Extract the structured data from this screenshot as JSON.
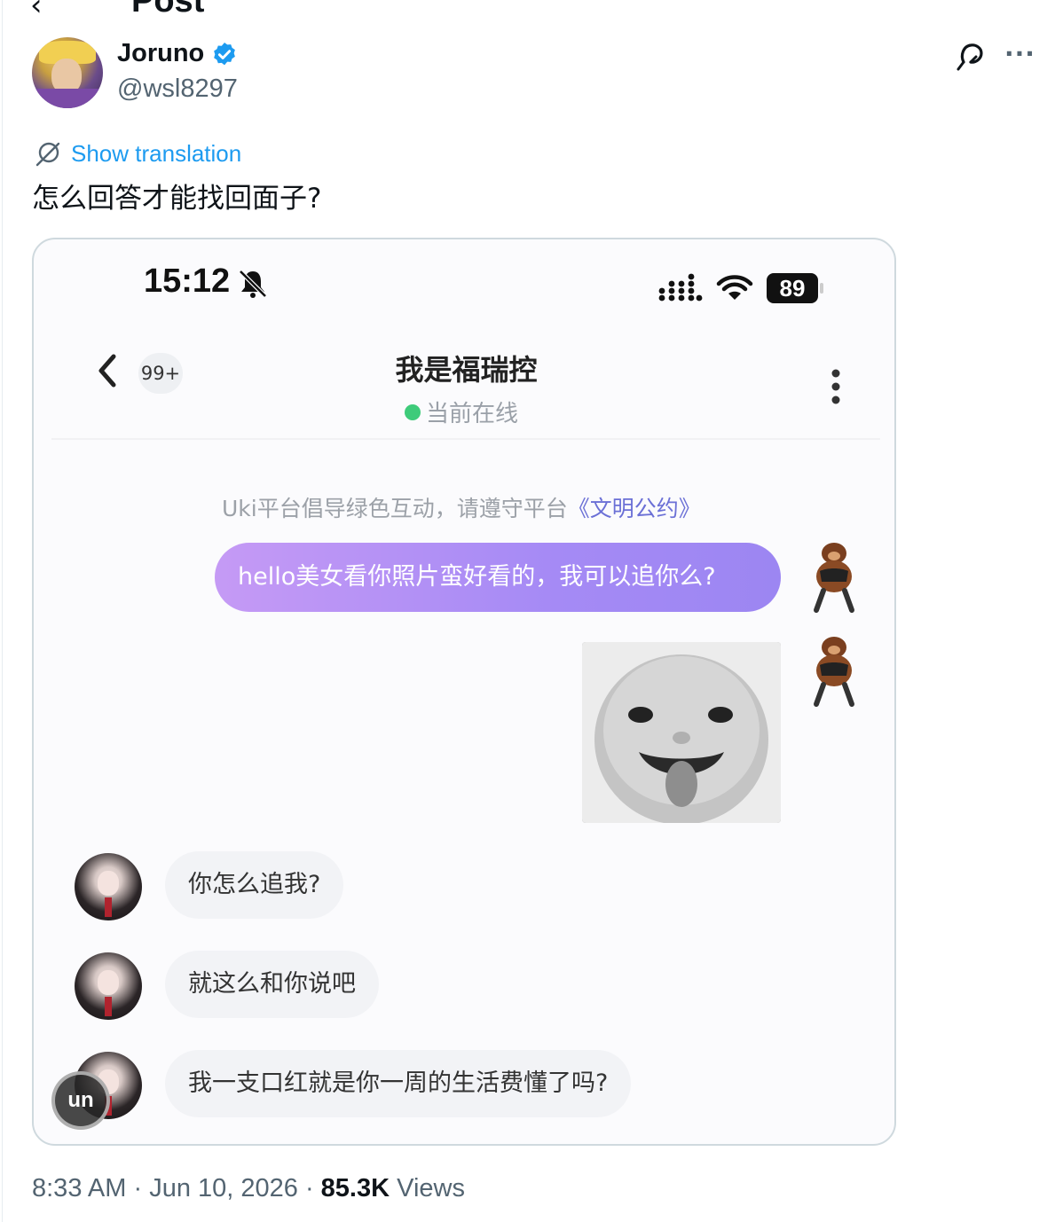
{
  "header": {
    "title": "Post",
    "back_glyph": "‹"
  },
  "author": {
    "name": "Joruno",
    "handle": "@wsl8297",
    "verified": true
  },
  "actions": {
    "more_glyph": "···"
  },
  "tweet": {
    "show_translation": "Show translation",
    "text": "怎么回答才能找回面子?"
  },
  "screenshot": {
    "status_bar": {
      "time": "15:12",
      "battery": "89"
    },
    "chat_header": {
      "unread_badge": "99+",
      "title": "我是福瑞控",
      "status": "当前在线"
    },
    "notice": {
      "text": "Uki平台倡导绿色互动，请遵守平台",
      "link": "《文明公约》"
    },
    "messages": [
      {
        "from": "me",
        "text": "hello美女看你照片蛮好看的，我可以追你么?"
      },
      {
        "from": "them",
        "text": "你怎么追我?"
      },
      {
        "from": "them",
        "text": "就这么和你说吧"
      },
      {
        "from": "them",
        "text": "我一支口红就是你一周的生活费懂了吗?"
      }
    ],
    "watermark": "un"
  },
  "meta": {
    "time": "8:33 AM",
    "separator": " · ",
    "date": "Jun 10, 2026",
    "views_count": "85.3K",
    "views_label": " Views"
  },
  "colors": {
    "link_blue": "#1d9bf0",
    "verified_blue": "#1d9bf0",
    "bubble_purple": "#a58af5",
    "online_green": "#3ecb7a"
  },
  "icons": [
    "back-arrow-icon",
    "verified-icon",
    "translate-icon",
    "more-icon",
    "globe-icon",
    "bell-muted-icon",
    "signal-icon",
    "wifi-icon",
    "battery-icon",
    "chevron-left-icon",
    "kebab-menu-icon"
  ]
}
